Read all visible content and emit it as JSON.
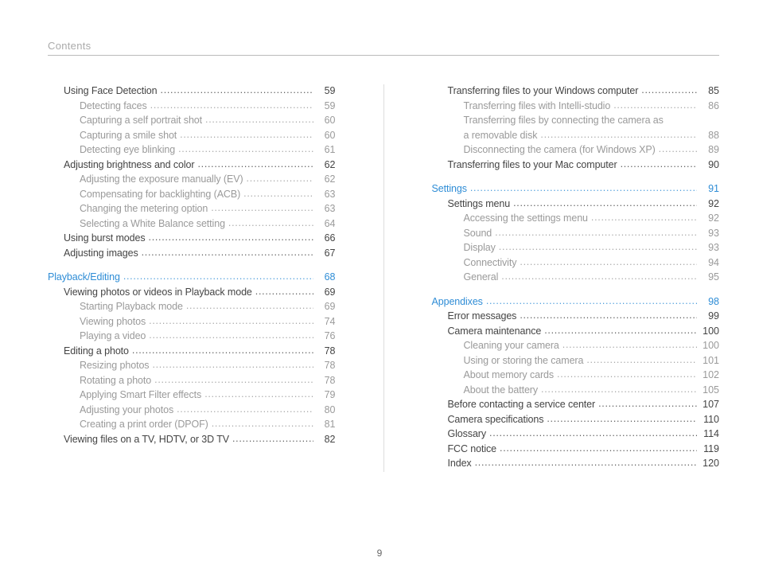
{
  "header": "Contents",
  "page_number": "9",
  "columns": [
    {
      "entries": [
        {
          "level": 2,
          "label": "Using Face Detection",
          "page": "59"
        },
        {
          "level": 3,
          "label": "Detecting faces",
          "page": "59"
        },
        {
          "level": 3,
          "label": "Capturing a self portrait shot",
          "page": "60"
        },
        {
          "level": 3,
          "label": "Capturing a smile shot",
          "page": "60"
        },
        {
          "level": 3,
          "label": "Detecting eye blinking",
          "page": "61"
        },
        {
          "level": 2,
          "label": "Adjusting brightness and color",
          "page": "62"
        },
        {
          "level": 3,
          "label": "Adjusting the exposure manually (EV)",
          "page": "62"
        },
        {
          "level": 3,
          "label": "Compensating for backlighting (ACB)",
          "page": "63"
        },
        {
          "level": 3,
          "label": "Changing the metering option",
          "page": "63"
        },
        {
          "level": 3,
          "label": "Selecting a White Balance setting",
          "page": "64"
        },
        {
          "level": 2,
          "label": "Using burst modes",
          "page": "66"
        },
        {
          "level": 2,
          "label": "Adjusting images",
          "page": "67"
        },
        {
          "spacer": true
        },
        {
          "level": 1,
          "section": true,
          "label": "Playback/Editing",
          "page": "68"
        },
        {
          "level": 2,
          "label": "Viewing photos or videos in Playback mode",
          "page": "69"
        },
        {
          "level": 3,
          "label": "Starting Playback mode",
          "page": "69"
        },
        {
          "level": 3,
          "label": "Viewing photos",
          "page": "74"
        },
        {
          "level": 3,
          "label": "Playing a video",
          "page": "76"
        },
        {
          "level": 2,
          "label": "Editing a photo",
          "page": "78"
        },
        {
          "level": 3,
          "label": "Resizing photos",
          "page": "78"
        },
        {
          "level": 3,
          "label": "Rotating a photo",
          "page": "78"
        },
        {
          "level": 3,
          "label": "Applying Smart Filter effects",
          "page": "79"
        },
        {
          "level": 3,
          "label": "Adjusting your photos",
          "page": "80"
        },
        {
          "level": 3,
          "label": "Creating a print order (DPOF)",
          "page": "81"
        },
        {
          "level": 2,
          "label": "Viewing files on a TV, HDTV, or 3D TV",
          "page": "82"
        }
      ]
    },
    {
      "entries": [
        {
          "level": 2,
          "label": "Transferring files to your Windows computer",
          "page": "85"
        },
        {
          "level": 3,
          "label": "Transferring files with Intelli-studio",
          "page": "86"
        },
        {
          "level": 3,
          "nopage": true,
          "label": "Transferring files by connecting the camera as"
        },
        {
          "level": 3,
          "label": "a removable disk",
          "page": "88"
        },
        {
          "level": 3,
          "label": "Disconnecting the camera (for Windows XP)",
          "page": "89"
        },
        {
          "level": 2,
          "label": "Transferring files to your Mac computer",
          "page": "90"
        },
        {
          "spacer": true
        },
        {
          "level": 1,
          "section": true,
          "label": "Settings",
          "page": "91"
        },
        {
          "level": 2,
          "label": "Settings menu",
          "page": "92"
        },
        {
          "level": 3,
          "label": "Accessing the settings menu",
          "page": "92"
        },
        {
          "level": 3,
          "label": "Sound",
          "page": "93"
        },
        {
          "level": 3,
          "label": "Display",
          "page": "93"
        },
        {
          "level": 3,
          "label": "Connectivity",
          "page": "94"
        },
        {
          "level": 3,
          "label": "General",
          "page": "95"
        },
        {
          "spacer": true
        },
        {
          "level": 1,
          "section": true,
          "label": "Appendixes",
          "page": "98"
        },
        {
          "level": 2,
          "label": "Error messages",
          "page": "99"
        },
        {
          "level": 2,
          "label": "Camera maintenance",
          "page": "100"
        },
        {
          "level": 3,
          "label": "Cleaning your camera",
          "page": "100"
        },
        {
          "level": 3,
          "label": "Using or storing the camera",
          "page": "101"
        },
        {
          "level": 3,
          "label": "About memory cards",
          "page": "102"
        },
        {
          "level": 3,
          "label": "About the battery",
          "page": "105"
        },
        {
          "level": 2,
          "label": "Before contacting a service center",
          "page": "107"
        },
        {
          "level": 2,
          "label": "Camera specifications",
          "page": "110"
        },
        {
          "level": 2,
          "label": "Glossary",
          "page": "114"
        },
        {
          "level": 2,
          "label": "FCC notice",
          "page": "119"
        },
        {
          "level": 2,
          "label": "Index",
          "page": "120"
        }
      ]
    }
  ]
}
